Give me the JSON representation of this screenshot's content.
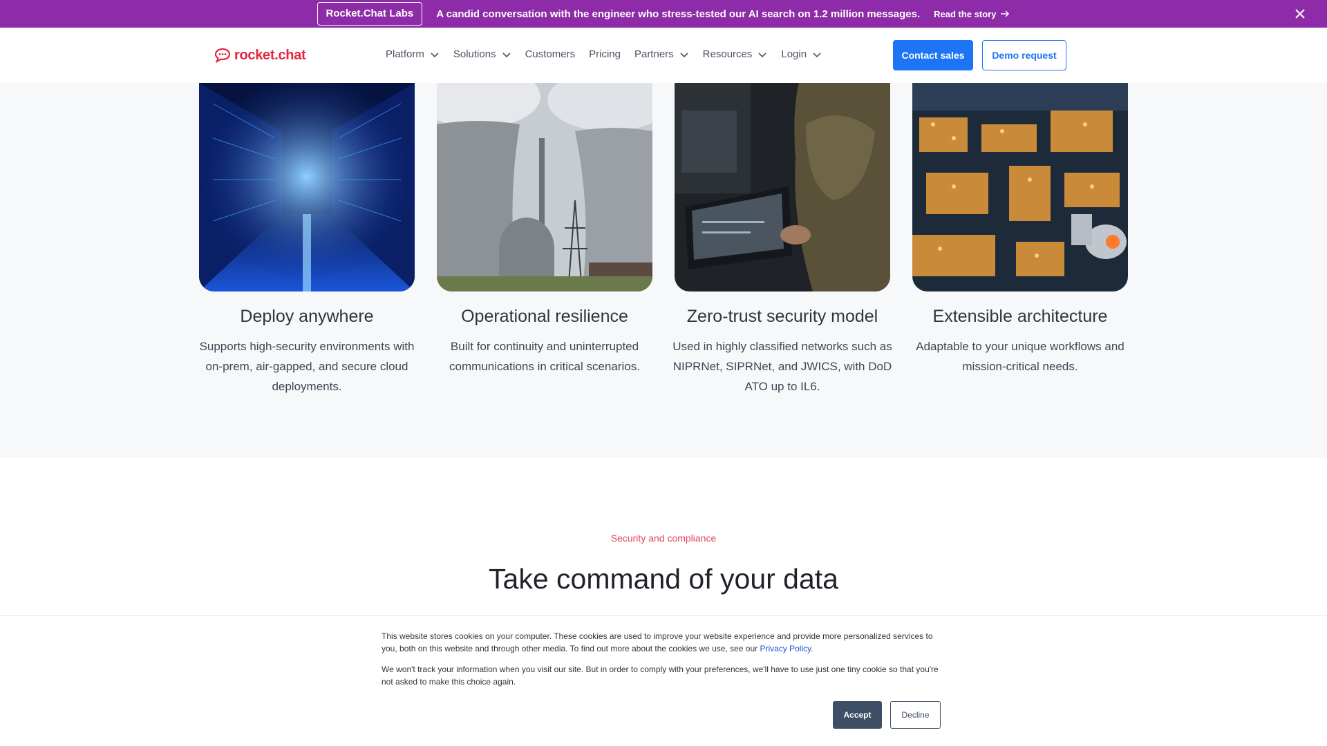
{
  "announcement": {
    "badge": "Rocket.Chat Labs",
    "text": "A candid conversation with the engineer who stress-tested our AI search on 1.2 million messages.",
    "link": "Read the story"
  },
  "nav": {
    "logo": "rocket.chat",
    "items": [
      {
        "label": "Platform",
        "dropdown": true
      },
      {
        "label": "Solutions",
        "dropdown": true
      },
      {
        "label": "Customers",
        "dropdown": false
      },
      {
        "label": "Pricing",
        "dropdown": false
      },
      {
        "label": "Partners",
        "dropdown": true
      },
      {
        "label": "Resources",
        "dropdown": true
      },
      {
        "label": "Login",
        "dropdown": true
      }
    ],
    "contact": "Contact sales",
    "demo": "Demo request"
  },
  "features": [
    {
      "title": "Deploy anywhere",
      "text": "Supports high-security environments with on-prem, air-gapped, and secure cloud deployments.",
      "image": "data-center-corridor"
    },
    {
      "title": "Operational resilience",
      "text": "Built for continuity and uninterrupted communications in critical scenarios.",
      "image": "cooling-towers"
    },
    {
      "title": "Zero-trust security model",
      "text": "Used in highly classified networks such as NIPRNet, SIPRNet, and JWICS, with DoD ATO up to IL6.",
      "image": "soldier-with-laptop"
    },
    {
      "title": "Extensible architecture",
      "text": "Adaptable to your unique workflows and mission-critical needs.",
      "image": "industrial-plant-night"
    }
  ],
  "security": {
    "eyebrow": "Security and compliance",
    "title": "Take command of your data"
  },
  "cookie": {
    "p1": "This website stores cookies on your computer. These cookies are used to improve your website experience and provide more personalized services to you, both on this website and through other media. To find out more about the cookies we use, see our ",
    "p1_link": "Privacy Policy",
    "p1_end": ".",
    "p2": "We won't track your information when you visit our site. But in order to comply with your preferences, we'll have to use just one tiny cookie so that you're not asked to make this choice again.",
    "accept": "Accept",
    "decline": "Decline"
  },
  "colors": {
    "announce_bg": "#8e2ba8",
    "brand_red": "#e5243f",
    "primary_blue": "#1d74f5",
    "cookie_button": "#3e4e64"
  }
}
